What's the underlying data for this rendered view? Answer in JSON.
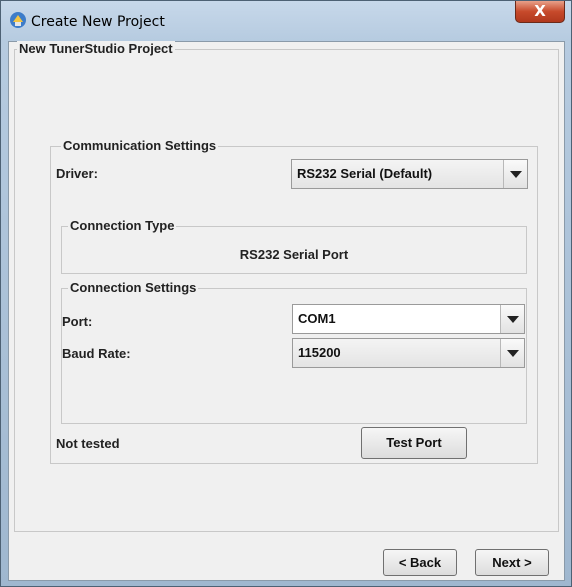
{
  "window": {
    "title": "Create New Project",
    "close_label": "X"
  },
  "project_group": {
    "legend": "New TunerStudio Project"
  },
  "comm": {
    "legend": "Communication Settings",
    "driver_label": "Driver:",
    "driver_value": "RS232 Serial (Default)",
    "connection_type": {
      "legend": "Connection Type",
      "value": "RS232 Serial Port"
    },
    "connection_settings": {
      "legend": "Connection Settings",
      "port_label": "Port:",
      "port_value": "COM1",
      "baud_label": "Baud Rate:",
      "baud_value": "115200"
    },
    "status": "Not tested",
    "test_button": "Test Port"
  },
  "nav": {
    "back_label": "< Back",
    "next_label": "Next >"
  },
  "icons": {
    "app": "tunerstudio-app-icon",
    "dropdown": "chevron-down-icon"
  }
}
